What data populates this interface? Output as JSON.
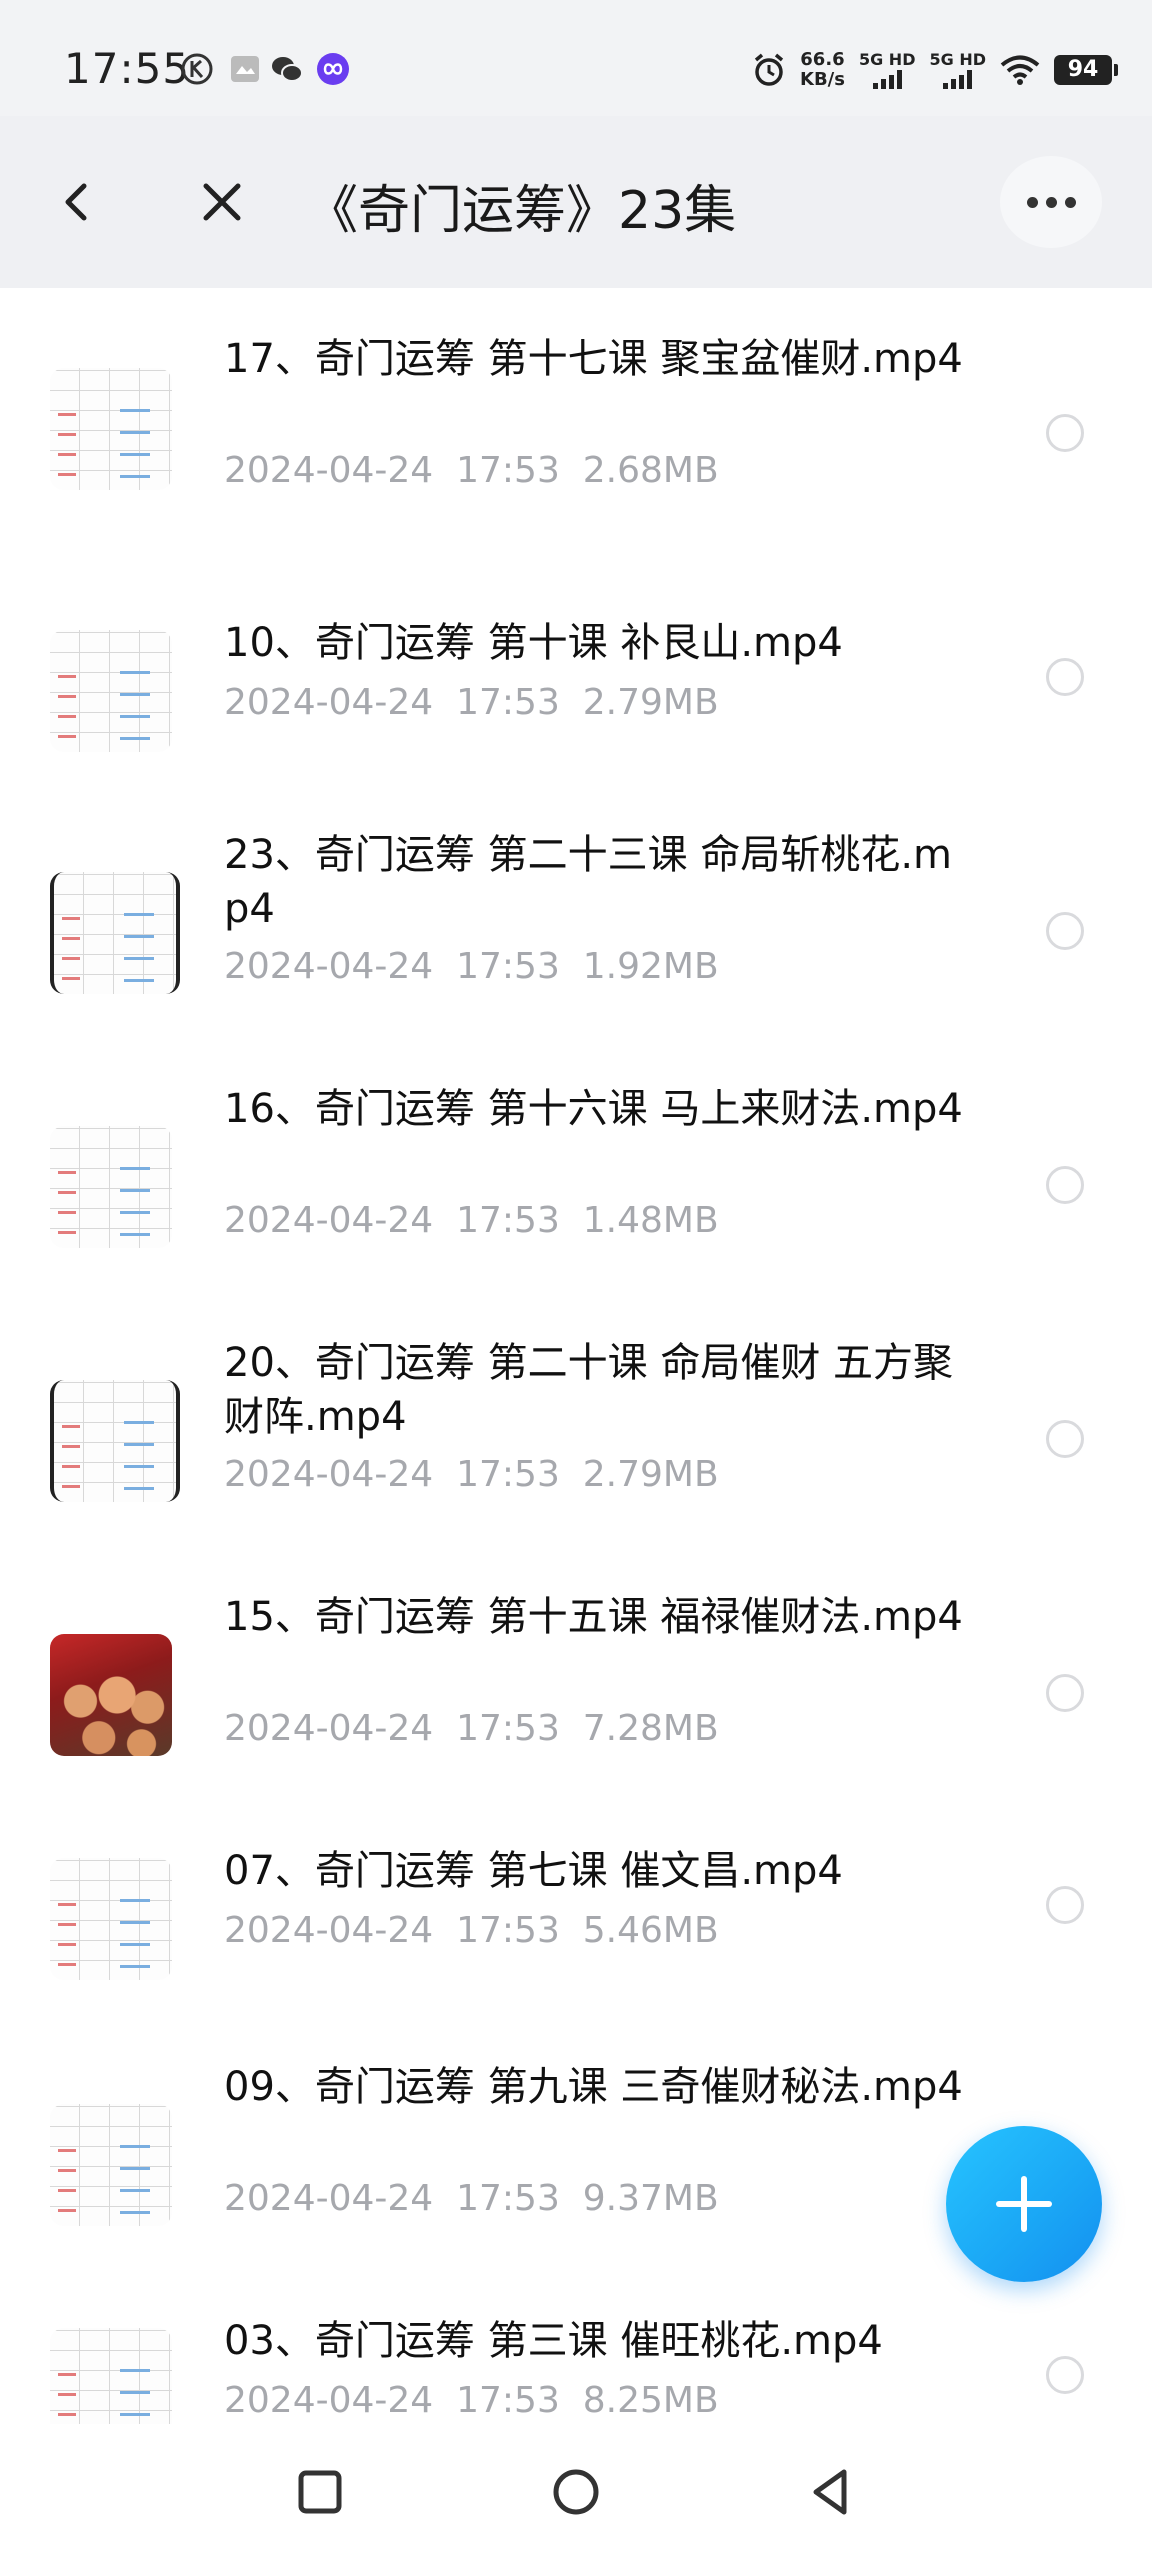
{
  "status_bar": {
    "time": "17:55",
    "net_speed_value": "66.6",
    "net_speed_unit": "KB/s",
    "signal1_label": "5G HD",
    "signal2_label": "5G HD",
    "battery": "94",
    "icons": [
      "k-circle-icon",
      "gallery-icon",
      "wechat-icon",
      "loop-app-icon",
      "alarm-icon",
      "wifi-icon"
    ]
  },
  "header": {
    "title": "《奇门运筹》23集"
  },
  "files": [
    {
      "name": "17、奇门运筹 第十七课 聚宝盆催财.mp4",
      "date": "2024-04-24",
      "time": "17:53",
      "size": "2.68MB",
      "thumb": "sheet"
    },
    {
      "name": "10、奇门运筹 第十课 补艮山.mp4",
      "date": "2024-04-24",
      "time": "17:53",
      "size": "2.79MB",
      "thumb": "sheet"
    },
    {
      "name": "23、奇门运筹 第二十三课 命局斩桃花.mp4",
      "date": "2024-04-24",
      "time": "17:53",
      "size": "1.92MB",
      "thumb": "sheet-dark"
    },
    {
      "name": "16、奇门运筹 第十六课 马上来财法.mp4",
      "date": "2024-04-24",
      "time": "17:53",
      "size": "1.48MB",
      "thumb": "sheet"
    },
    {
      "name": "20、奇门运筹 第二十课 命局催财 五方聚财阵.mp4",
      "date": "2024-04-24",
      "time": "17:53",
      "size": "2.79MB",
      "thumb": "sheet-dark"
    },
    {
      "name": "15、奇门运筹 第十五课 福禄催财法.mp4",
      "date": "2024-04-24",
      "time": "17:53",
      "size": "7.28MB",
      "thumb": "photo"
    },
    {
      "name": "07、奇门运筹 第七课 催文昌.mp4",
      "date": "2024-04-24",
      "time": "17:53",
      "size": "5.46MB",
      "thumb": "sheet"
    },
    {
      "name": "09、奇门运筹 第九课 三奇催财秘法.mp4",
      "date": "2024-04-24",
      "time": "17:53",
      "size": "9.37MB",
      "thumb": "sheet"
    },
    {
      "name": "03、奇门运筹 第三课 催旺桃花.mp4",
      "date": "2024-04-24",
      "time": "17:53",
      "size": "8.25MB",
      "thumb": "sheet"
    }
  ],
  "colors": {
    "accent": "#1aa6f5",
    "meta_text": "#a6a8ad",
    "header_bg": "#eff0f3"
  }
}
